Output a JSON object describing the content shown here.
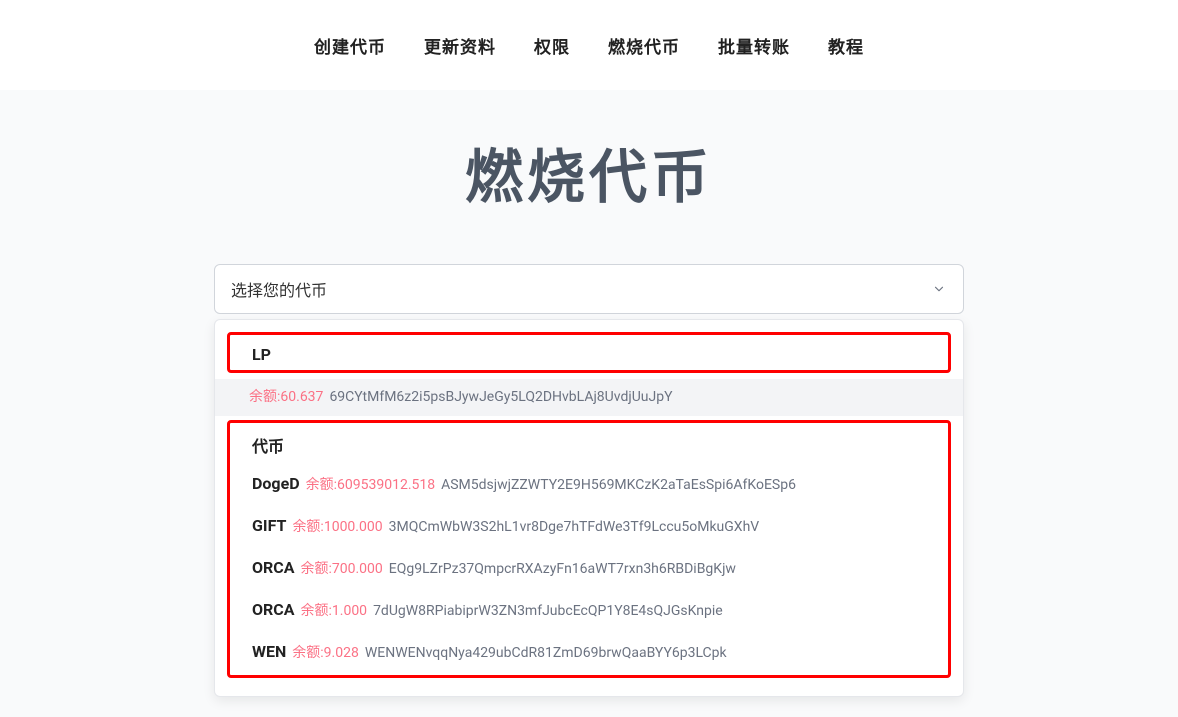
{
  "nav": {
    "items": [
      "创建代币",
      "更新资料",
      "权限",
      "燃烧代币",
      "批量转账",
      "教程"
    ]
  },
  "page": {
    "title": "燃烧代币"
  },
  "select": {
    "placeholder": "选择您的代币"
  },
  "groups": {
    "lp": {
      "header": "LP",
      "items": [
        {
          "name": "",
          "balance": "余额:60.637",
          "address": "69CYtMfM6z2i5psBJywJeGy5LQ2DHvbLAj8UvdjUuJpY"
        }
      ]
    },
    "token": {
      "header": "代币",
      "items": [
        {
          "name": "DogeD",
          "balance": "余额:609539012.518",
          "address": "ASM5dsjwjZZWTY2E9H569MKCzK2aTaEsSpi6AfKoESp6"
        },
        {
          "name": "GIFT",
          "balance": "余额:1000.000",
          "address": "3MQCmWbW3S2hL1vr8Dge7hTFdWe3Tf9Lccu5oMkuGXhV"
        },
        {
          "name": "ORCA",
          "balance": "余额:700.000",
          "address": "EQg9LZrPz37QmpcrRXAzyFn16aWT7rxn3h6RBDiBgKjw"
        },
        {
          "name": "ORCA",
          "balance": "余额:1.000",
          "address": "7dUgW8RPiabiprW3ZN3mfJubcEcQP1Y8E4sQJGsKnpie"
        },
        {
          "name": "WEN",
          "balance": "余额:9.028",
          "address": "WENWENvqqNya429ubCdR81ZmD69brwQaaBYY6p3LCpk"
        }
      ]
    }
  }
}
